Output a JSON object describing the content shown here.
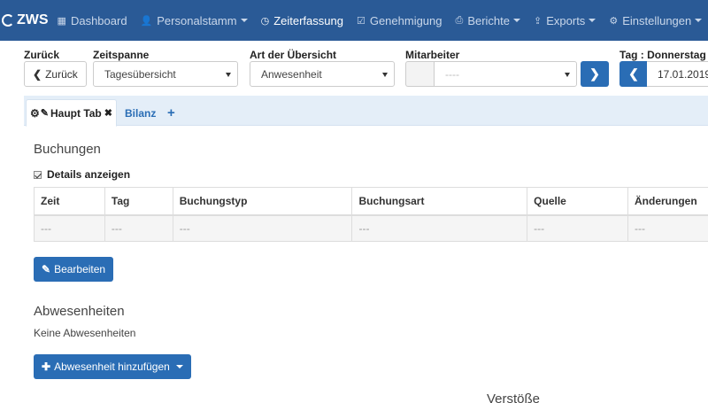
{
  "navbar": {
    "brand": "ZWS",
    "items": [
      {
        "label": "Dashboard",
        "icon": "grid-icon",
        "glyph": "▦",
        "dropdown": false,
        "active": false
      },
      {
        "label": "Personalstamm",
        "icon": "user-icon",
        "glyph": "👤",
        "dropdown": true,
        "active": false
      },
      {
        "label": "Zeiterfassung",
        "icon": "clock-icon",
        "glyph": "◷",
        "dropdown": false,
        "active": true
      },
      {
        "label": "Genehmigung",
        "icon": "check-square-icon",
        "glyph": "☑",
        "dropdown": false,
        "active": false
      },
      {
        "label": "Berichte",
        "icon": "print-icon",
        "glyph": "⎙",
        "dropdown": true,
        "active": false
      },
      {
        "label": "Exports",
        "icon": "export-icon",
        "glyph": "⇪",
        "dropdown": true,
        "active": false
      },
      {
        "label": "Einstellungen",
        "icon": "gear-icon",
        "glyph": "⚙",
        "dropdown": true,
        "active": false
      }
    ]
  },
  "filters": {
    "back": {
      "label": "Zurück",
      "button": "Zurück"
    },
    "zeitspanne": {
      "label": "Zeitspanne",
      "value": "Tagesübersicht"
    },
    "uebersicht": {
      "label": "Art der Übersicht",
      "value": "Anwesenheit"
    },
    "mitarbeiter": {
      "label": "Mitarbeiter",
      "value": "----"
    },
    "tag": {
      "label": "Tag : Donnerstag",
      "date": "17.01.2019"
    }
  },
  "tabs": {
    "active": "Haupt Tab",
    "second": "Bilanz",
    "add": "+"
  },
  "buchungen": {
    "title": "Buchungen",
    "details_label": "Details anzeigen",
    "columns": [
      "Zeit",
      "Tag",
      "Buchungstyp",
      "Buchungsart",
      "Quelle",
      "Änderungen"
    ],
    "row": [
      "---",
      "---",
      "---",
      "---",
      "---",
      "---"
    ],
    "edit_button": "Bearbeiten"
  },
  "abwesenheiten": {
    "title": "Abwesenheiten",
    "empty_text": "Keine Abwesenheiten",
    "add_button": "Abwesenheit hinzufügen"
  },
  "verstoesse": {
    "title": "Verstöße"
  },
  "colors": {
    "navbar": "#2a5a96",
    "primary": "#2a6db5",
    "tabsbar": "#e4eef8"
  }
}
